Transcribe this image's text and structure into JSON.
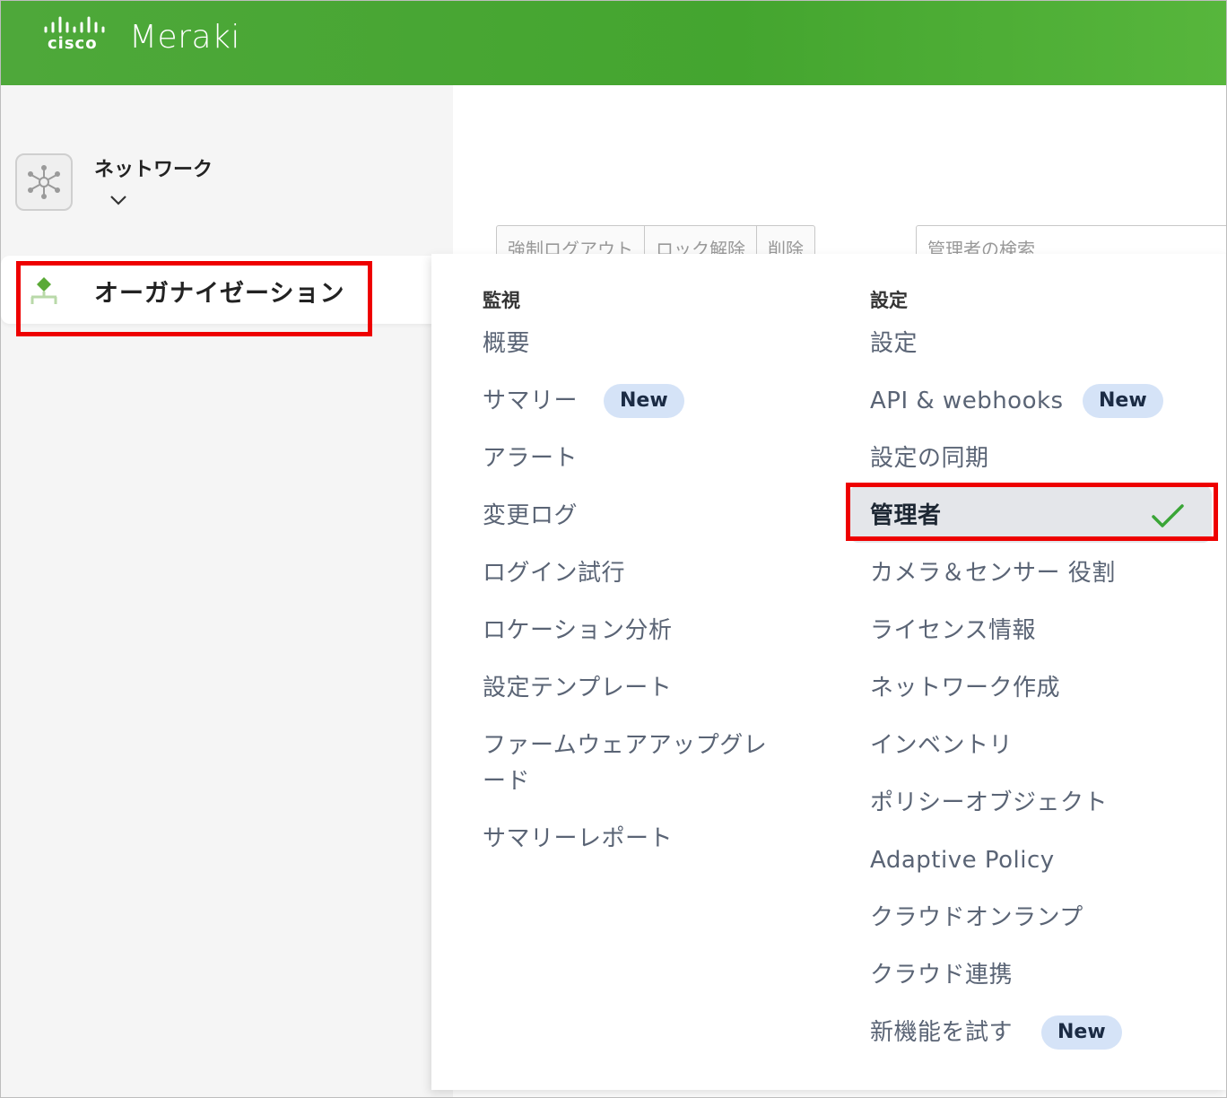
{
  "header": {
    "cisco_text": "cisco",
    "product_name": "Meraki",
    "bg_color": "#48a833"
  },
  "sidebar": {
    "network": {
      "label": "ネットワーク",
      "icon": "network-hub-icon"
    },
    "organization": {
      "label": "オーガナイゼーション",
      "icon": "organization-tree-icon",
      "highlighted": true
    }
  },
  "background": {
    "buttons": [
      "強制ログアウト",
      "ロック解除",
      "削除"
    ],
    "search_placeholder": "管理者の検索"
  },
  "menu": {
    "monitor": {
      "heading": "監視",
      "items": [
        {
          "label": "概要"
        },
        {
          "label": "サマリー",
          "badge": "New"
        },
        {
          "label": "アラート"
        },
        {
          "label": "変更ログ"
        },
        {
          "label": "ログイン試行"
        },
        {
          "label": "ロケーション分析"
        },
        {
          "label": "設定テンプレート"
        },
        {
          "label": "ファームウェアアップグレード"
        },
        {
          "label": "サマリーレポート"
        }
      ]
    },
    "configure": {
      "heading": "設定",
      "items": [
        {
          "label": "設定"
        },
        {
          "label": "API & webhooks",
          "badge": "New"
        },
        {
          "label": "設定の同期"
        },
        {
          "label": "管理者",
          "selected": true
        },
        {
          "label": "カメラ＆センサー 役割"
        },
        {
          "label": "ライセンス情報"
        },
        {
          "label": "ネットワーク作成"
        },
        {
          "label": "インベントリ"
        },
        {
          "label": "ポリシーオブジェクト"
        },
        {
          "label": "Adaptive Policy"
        },
        {
          "label": "クラウドオンランプ"
        },
        {
          "label": "クラウド連携"
        },
        {
          "label": "新機能を試す",
          "badge": "New"
        }
      ]
    }
  },
  "colors": {
    "highlight": "#ee0000",
    "badge_bg": "#d5e3f7",
    "check": "#3aa537"
  }
}
